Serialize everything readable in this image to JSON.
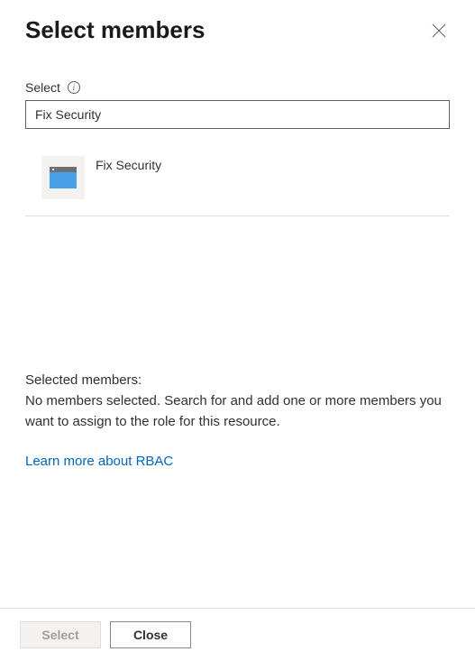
{
  "header": {
    "title": "Select members"
  },
  "select": {
    "label": "Select",
    "input_value": "Fix Security"
  },
  "results": {
    "items": [
      {
        "name": "Fix Security"
      }
    ]
  },
  "selected": {
    "heading": "Selected members:",
    "empty_text": "No members selected. Search for and add one or more members you want to assign to the role for this resource."
  },
  "link": {
    "learn_more": "Learn more about RBAC"
  },
  "footer": {
    "select_label": "Select",
    "close_label": "Close"
  }
}
